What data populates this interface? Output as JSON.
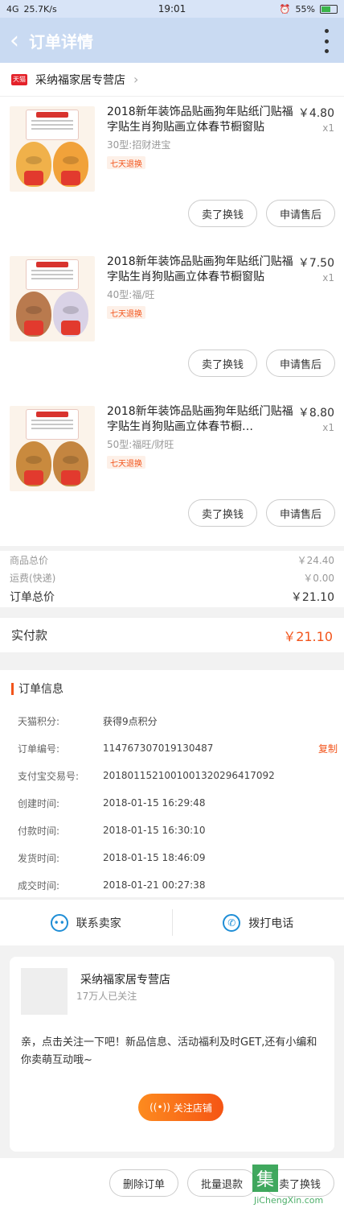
{
  "status": {
    "signal": "4G ",
    "speed": "25.7K/s",
    "time": "19:01",
    "battery": "55%"
  },
  "header": {
    "title": "订单详情"
  },
  "shop": {
    "badge": "天猫",
    "name": "采纳福家居专营店"
  },
  "items": [
    {
      "title": "2018新年装饰品贴画狗年贴纸门贴福字贴生肖狗贴画立体春节橱窗贴",
      "price": "￥4.80",
      "qty": "x1",
      "spec": "30型:招财进宝",
      "tag": "七天退换",
      "sell_label": "卖了换钱",
      "after_label": "申请售后",
      "dog_colors": [
        "#f0b14a",
        "#f1a23a"
      ]
    },
    {
      "title": "2018新年装饰品贴画狗年贴纸门贴福字贴生肖狗贴画立体春节橱窗贴",
      "price": "￥7.50",
      "qty": "x1",
      "spec": "40型:福/旺",
      "tag": "七天退换",
      "sell_label": "卖了换钱",
      "after_label": "申请售后",
      "dog_colors": [
        "#b97a4e",
        "#d9d2e6"
      ]
    },
    {
      "title": "2018新年装饰品贴画狗年贴纸门贴福字贴生肖狗贴画立体春节橱…",
      "price": "￥8.80",
      "qty": "x1",
      "spec": "50型:福旺/财旺",
      "tag": "七天退换",
      "sell_label": "卖了换钱",
      "after_label": "申请售后",
      "dog_colors": [
        "#c98a3e",
        "#c48540"
      ]
    }
  ],
  "summary": {
    "goods_label": "商品总价",
    "goods_value": "￥24.40",
    "ship_label": "运费(快递)",
    "ship_value": "￥0.00",
    "order_label": "订单总价",
    "order_value": "￥21.10",
    "paid_label": "实付款",
    "paid_value": "￥21.10"
  },
  "order_info": {
    "heading": "订单信息",
    "rows": [
      {
        "k": "天猫积分:",
        "v": "获得9点积分"
      },
      {
        "k": "订单编号:",
        "v": "114767307019130487",
        "action": "复制"
      },
      {
        "k": "支付宝交易号:",
        "v": "2018011521001001320296417092"
      },
      {
        "k": "创建时间:",
        "v": "2018-01-15 16:29:48"
      },
      {
        "k": "付款时间:",
        "v": "2018-01-15 16:30:10"
      },
      {
        "k": "发货时间:",
        "v": "2018-01-15 18:46:09"
      },
      {
        "k": "成交时间:",
        "v": "2018-01-21 00:27:38"
      }
    ]
  },
  "contact": {
    "seller_label": "联系卖家",
    "phone_label": "拨打电话"
  },
  "card": {
    "name": "采纳福家居专营店",
    "fans": "17万人已关注",
    "message": "亲，点击关注一下吧！新品信息、活动福利及时GET,还有小编和你卖萌互动哦~",
    "follow_label": "关注店铺"
  },
  "footer": {
    "delete_label": "删除订单",
    "refund_label": "批量退款",
    "sell_label": "卖了换钱"
  },
  "watermark": {
    "box": "集",
    "text": "JiChengXin.com"
  }
}
